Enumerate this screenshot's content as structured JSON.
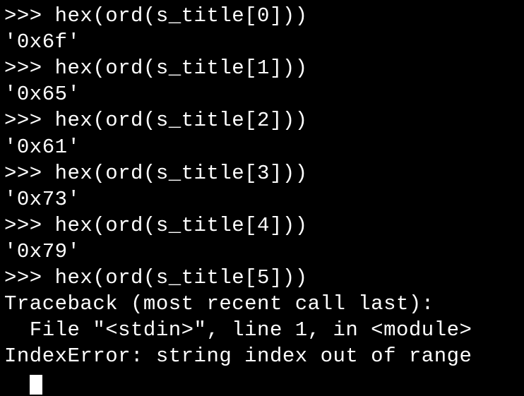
{
  "terminal": {
    "lines": [
      ">>> hex(ord(s_title[0]))",
      "'0x6f'",
      ">>> hex(ord(s_title[1]))",
      "'0x65'",
      ">>> hex(ord(s_title[2]))",
      "'0x61'",
      ">>> hex(ord(s_title[3]))",
      "'0x73'",
      ">>> hex(ord(s_title[4]))",
      "'0x79'",
      ">>> hex(ord(s_title[5]))",
      "Traceback (most recent call last):",
      "  File \"<stdin>\", line 1, in <module>",
      "IndexError: string index out of range"
    ]
  }
}
